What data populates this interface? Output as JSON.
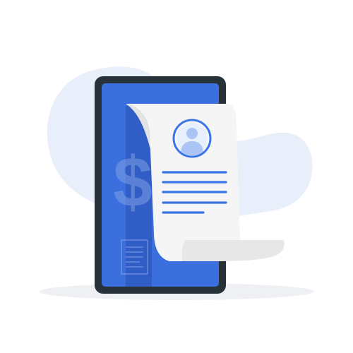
{
  "illustration": {
    "icon_names": {
      "background": "background-blob",
      "phone": "smartphone-icon",
      "dollar": "dollar-sign-icon",
      "receipt": "receipt-document",
      "avatar": "user-avatar-icon",
      "mini_receipt": "mini-receipt-icon"
    },
    "text_lines_count": 4,
    "dollar_glyph": "$"
  },
  "colors": {
    "blob": "#e9effa",
    "shadow": "#eceef1",
    "phone_frame": "#263238",
    "phone_screen": "#3b6fde",
    "screen_dark_band": "#2f5cc2",
    "receipt_paper": "#f4f4f4",
    "receipt_curl": "#e6e6e6",
    "accent_blue": "#3b74e6",
    "avatar_light": "#a9c4f5",
    "avatar_bg": "#e7effc"
  }
}
